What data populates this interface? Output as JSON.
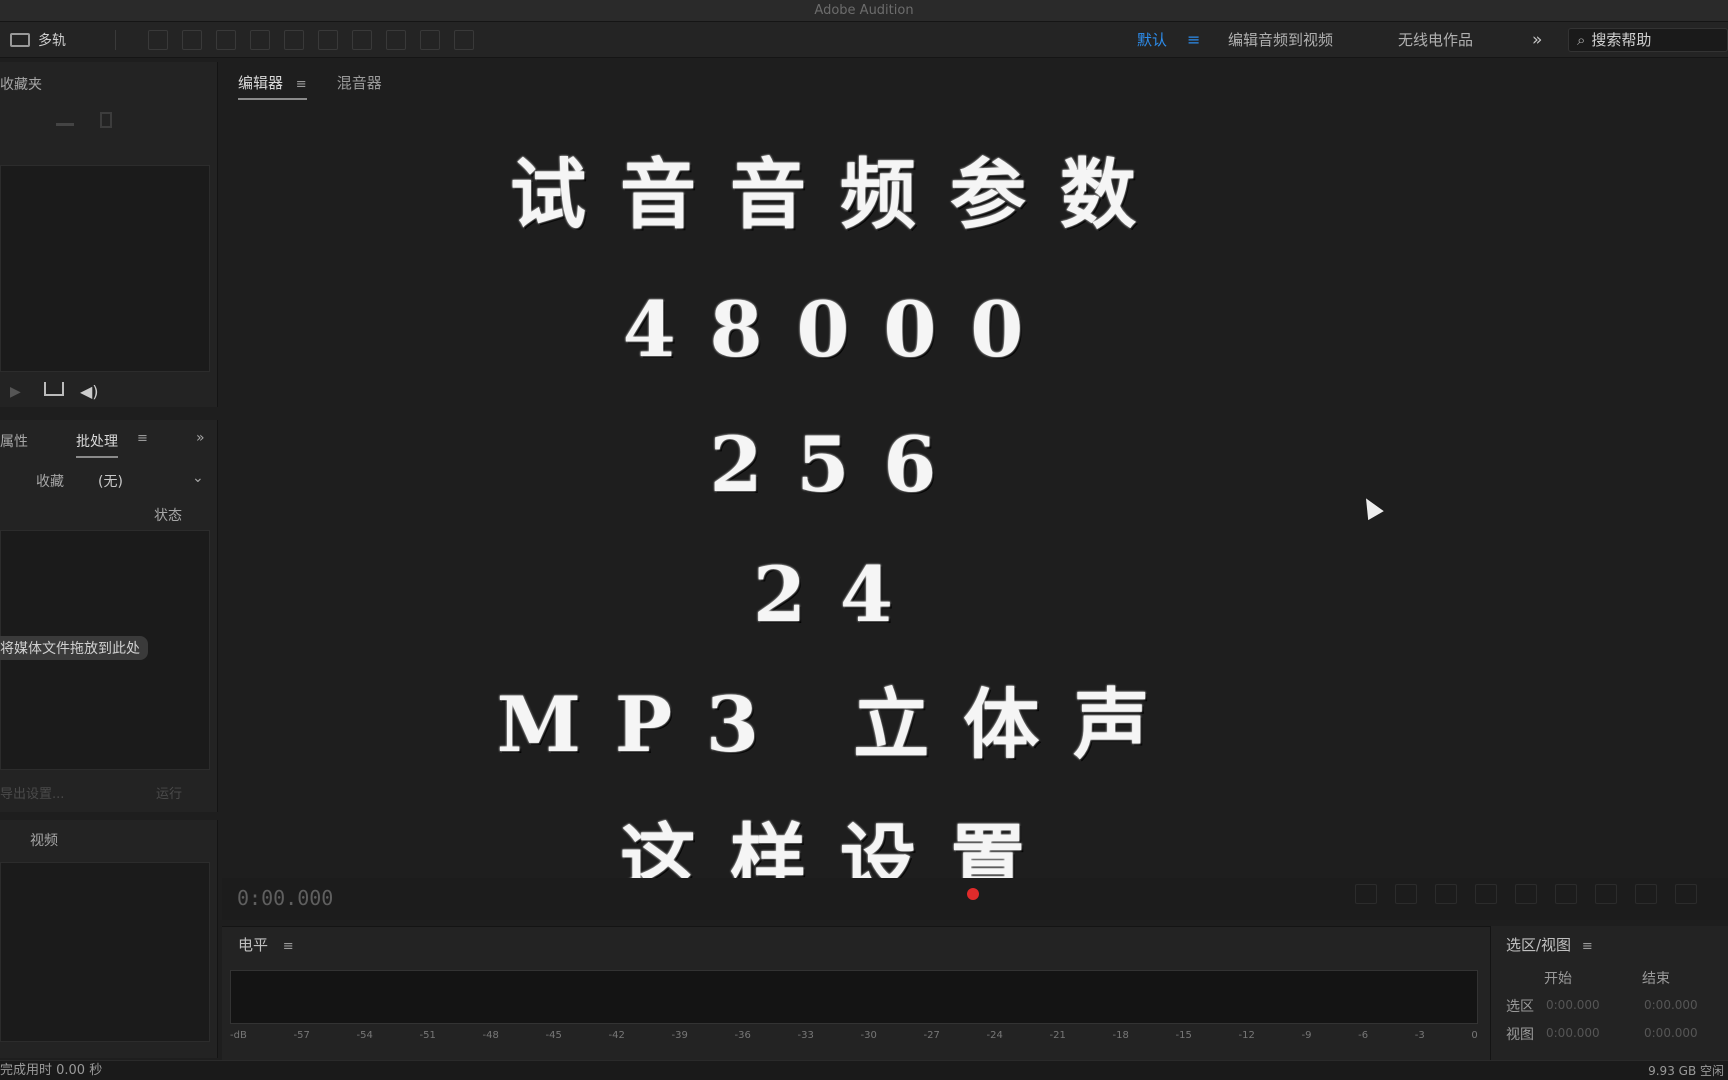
{
  "window": {
    "title": "Adobe Audition"
  },
  "toolbar": {
    "multitrack_label": "多轨",
    "workspace_default": "默认",
    "workspace_menu": "≡",
    "workspace_edit_video": "编辑音频到视频",
    "workspace_radio": "无线电作品",
    "more": "»",
    "search_placeholder": "搜索帮助"
  },
  "left_panels": {
    "favorites_title": "收藏夹",
    "props_tab": "属性",
    "batch_tab": "批处理",
    "batch_menu": "≡",
    "favorites_label": "收藏",
    "favorites_value": "(无)",
    "status_col": "状态",
    "drop_hint": "将媒体文件拖放到此处",
    "export_settings": "导出设置...",
    "run_btn": "运行",
    "video_tab": "视频"
  },
  "editor": {
    "tab_editor": "编辑器",
    "tab_menu": "≡",
    "tab_mixer": "混音器",
    "time": "0:00.000"
  },
  "overlay": {
    "line1": "试音音频参数",
    "line2": "48000",
    "line3": "256",
    "line4": "24",
    "line5": "MP3 立体声",
    "line6": "这样设置"
  },
  "levels": {
    "title": "电平",
    "menu": "≡",
    "ticks": [
      "-dB",
      "-57",
      "-54",
      "-51",
      "-48",
      "-45",
      "-42",
      "-39",
      "-36",
      "-33",
      "-30",
      "-27",
      "-24",
      "-21",
      "-18",
      "-15",
      "-12",
      "-9",
      "-6",
      "-3",
      "0"
    ]
  },
  "selection_view": {
    "title": "选区/视图",
    "menu": "≡",
    "col_start": "开始",
    "col_end": "结束",
    "row_selection": "选区",
    "row_view": "视图",
    "sel_start": "0:00.000",
    "sel_end": "0:00.000",
    "view_start": "0:00.000",
    "view_end": "0:00.000"
  },
  "status": {
    "left": "完成用时 0.00 秒",
    "right": "9.93 GB 空闲"
  }
}
